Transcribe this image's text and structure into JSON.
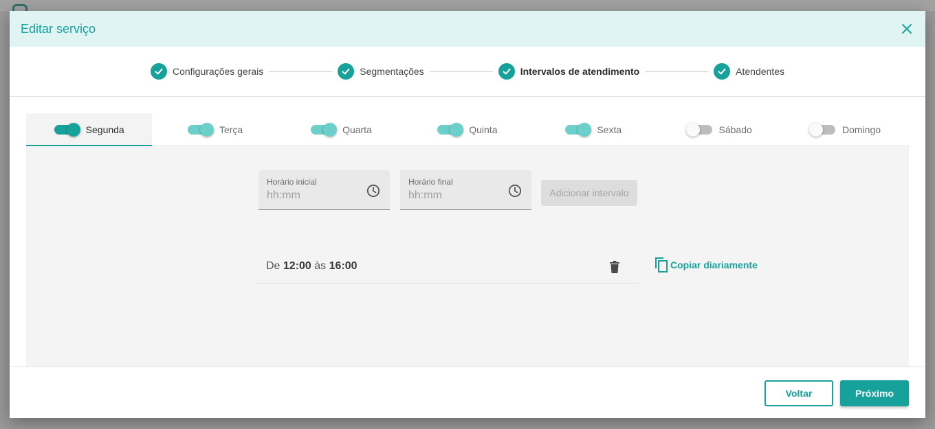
{
  "dialog": {
    "title": "Editar serviço",
    "close_icon": "close-icon"
  },
  "stepper": {
    "steps": [
      {
        "label": "Configurações gerais",
        "done": true
      },
      {
        "label": "Segmentações",
        "done": true
      },
      {
        "label": "Intervalos de atendimento",
        "done": true,
        "active": true
      },
      {
        "label": "Atendentes",
        "done": true
      }
    ]
  },
  "days": [
    {
      "label": "Segunda",
      "enabled": true,
      "selected": true
    },
    {
      "label": "Terça",
      "enabled": true
    },
    {
      "label": "Quarta",
      "enabled": true
    },
    {
      "label": "Quinta",
      "enabled": true
    },
    {
      "label": "Sexta",
      "enabled": true
    },
    {
      "label": "Sábado",
      "enabled": false
    },
    {
      "label": "Domingo",
      "enabled": false
    }
  ],
  "form": {
    "start_label": "Horário inicial",
    "start_placeholder": "hh:mm",
    "end_label": "Horário final",
    "end_placeholder": "hh:mm",
    "add_button": "Adicionar intervalo"
  },
  "interval": {
    "prefix": "De",
    "start": "12:00",
    "middle": "às",
    "end": "16:00"
  },
  "copy_daily": "Copiar diariamente",
  "footer": {
    "back_label": "Voltar",
    "next_label": "Próximo"
  },
  "colors": {
    "accent": "#16a19b",
    "header_bg": "#e0f4f3",
    "panel_bg": "#f4f4f4"
  }
}
